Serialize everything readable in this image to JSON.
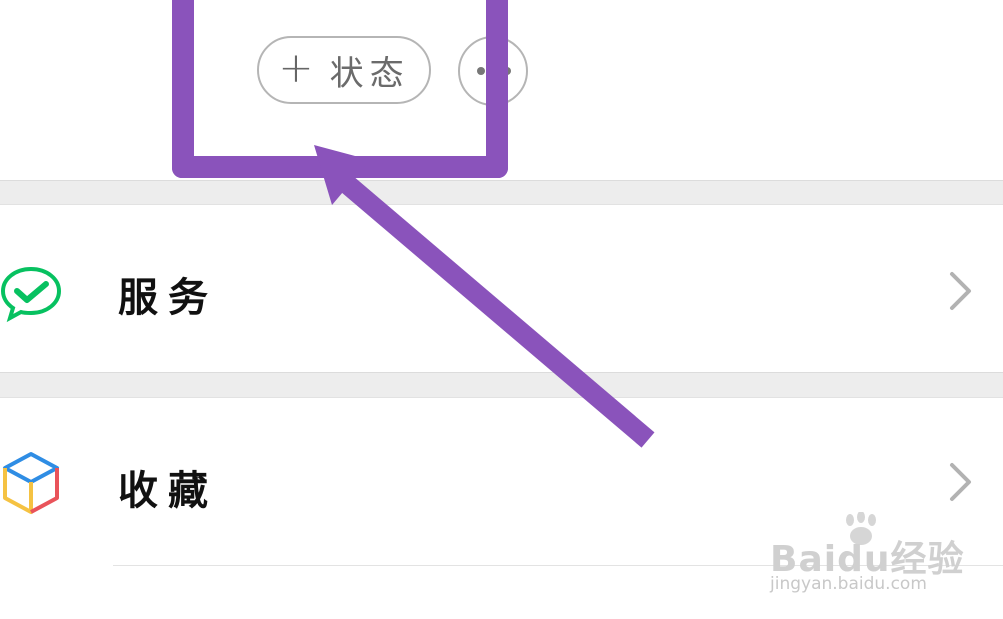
{
  "header": {
    "status_button": {
      "plus_glyph": "+",
      "label": "状态"
    },
    "more_button": {
      "icon": "more-dots-icon"
    }
  },
  "menu": {
    "items": [
      {
        "label": "服务",
        "icon": "wechat-pay-icon",
        "icon_color": "#07c160",
        "chevron": "chevron-right-icon"
      },
      {
        "label": "收藏",
        "icon": "favorites-cube-icon",
        "icon_colors": [
          "#2f8de4",
          "#f5c242",
          "#e9535a"
        ],
        "chevron": "chevron-right-icon"
      }
    ]
  },
  "annotation": {
    "color": "#8a53bb",
    "shape": "highlight-box-with-arrow"
  },
  "watermark": {
    "brand": "Baidu经验",
    "url": "jingyan.baidu.com"
  },
  "colors": {
    "background": "#ffffff",
    "separator": "#ededed",
    "text": "#111111",
    "chevron": "#b2b2b2"
  }
}
